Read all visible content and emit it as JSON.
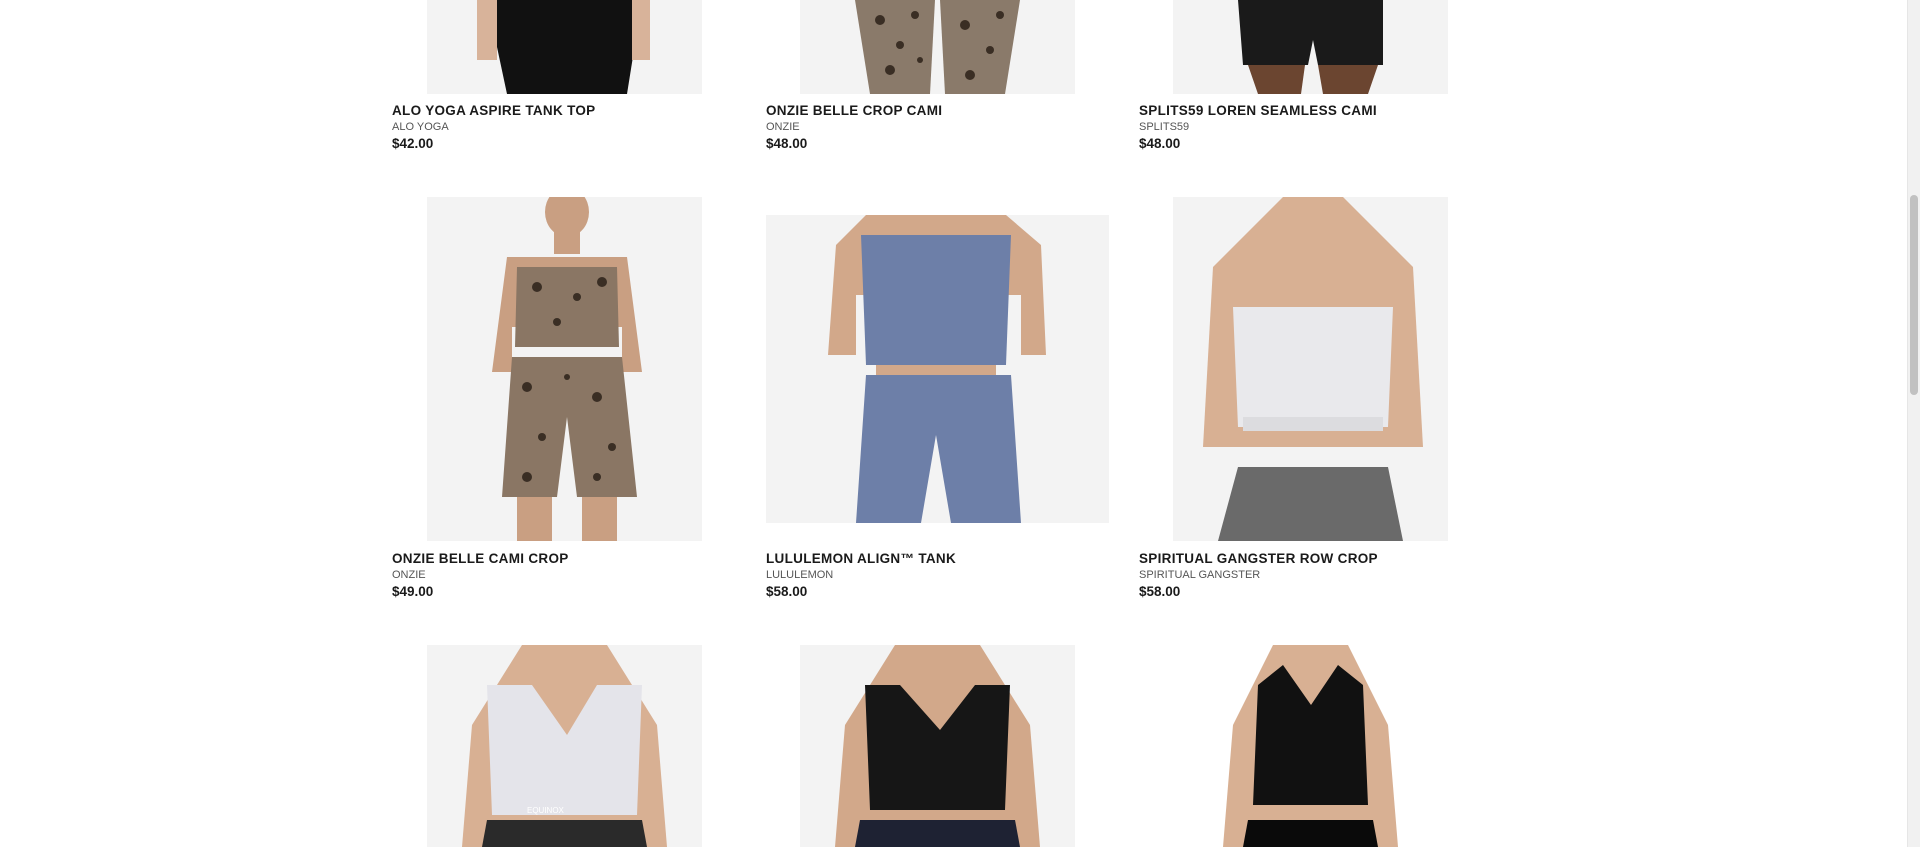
{
  "products": [
    {
      "name": "ALO YOGA ASPIRE TANK TOP",
      "brand": "ALO YOGA",
      "price": "$42.00"
    },
    {
      "name": "ONZIE BELLE CROP CAMI",
      "brand": "ONZIE",
      "price": "$48.00"
    },
    {
      "name": "SPLITS59 LOREN SEAMLESS CAMI",
      "brand": "SPLITS59",
      "price": "$48.00"
    },
    {
      "name": "ONZIE BELLE CAMI CROP",
      "brand": "ONZIE",
      "price": "$49.00"
    },
    {
      "name": "LULULEMON ALIGN™ TANK",
      "brand": "LULULEMON",
      "price": "$58.00"
    },
    {
      "name": "SPIRITUAL GANGSTER ROW CROP",
      "brand": "SPIRITUAL GANGSTER",
      "price": "$58.00"
    },
    {
      "name": "",
      "brand": "",
      "price": ""
    },
    {
      "name": "",
      "brand": "",
      "price": ""
    },
    {
      "name": "",
      "brand": "",
      "price": ""
    }
  ],
  "image_overlay_text": {
    "white_tank_logo": "EQUINOX"
  },
  "colors": {
    "background": "#ffffff",
    "image_background": "#f3f3f3",
    "text": "#1a1a1a",
    "brand_text": "#555555"
  }
}
